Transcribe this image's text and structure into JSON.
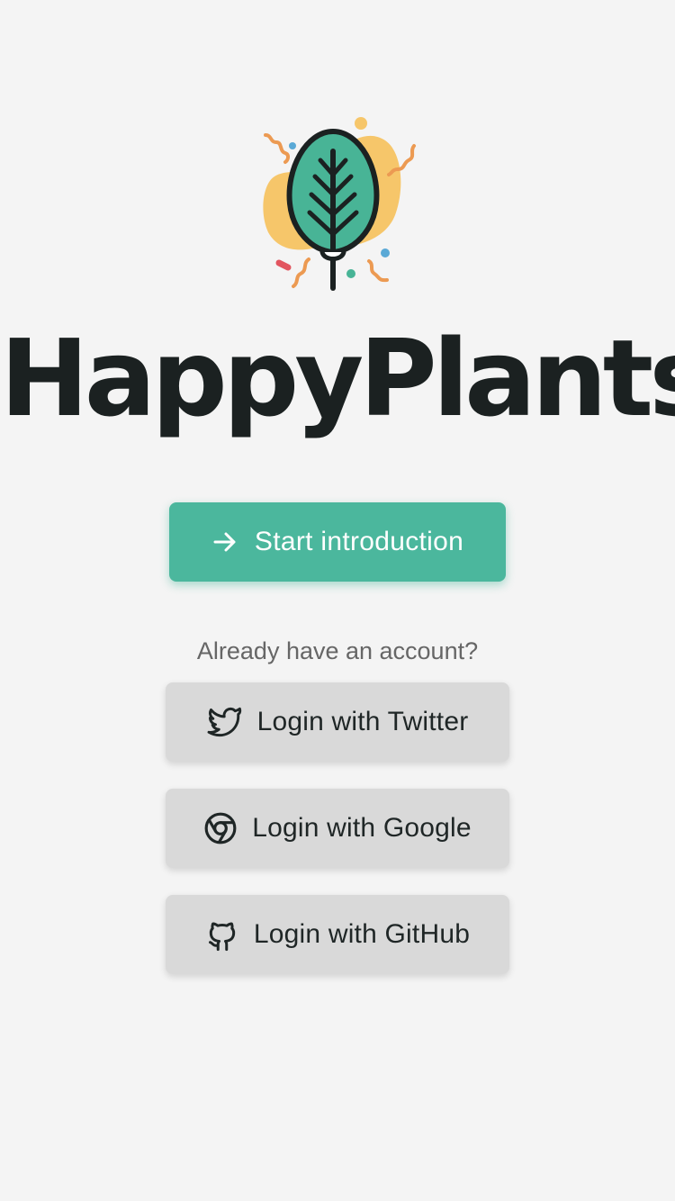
{
  "app": {
    "name": "HappyPlants"
  },
  "primary_action": {
    "label": "Start introduction",
    "icon": "arrow-right-icon"
  },
  "login": {
    "prompt": "Already have an account?",
    "buttons": [
      {
        "label": "Login with Twitter",
        "icon": "twitter-icon"
      },
      {
        "label": "Login with Google",
        "icon": "chrome-icon"
      },
      {
        "label": "Login with GitHub",
        "icon": "github-icon"
      }
    ]
  },
  "colors": {
    "background": "#f4f4f4",
    "accent": "#4bb79d",
    "leaf": "#48b496",
    "blob": "#f6c66a",
    "text": "#1b2121",
    "secondary_button": "#d9d9d9",
    "muted_text": "#666666"
  }
}
